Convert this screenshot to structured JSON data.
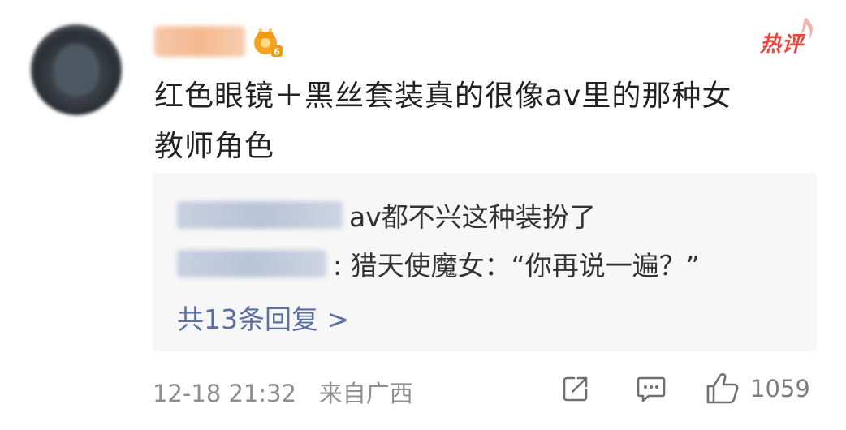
{
  "comment": {
    "hot_label": "热评",
    "level_badge": "6",
    "line1": "红色眼镜＋黑丝套装真的很像av里的那种女",
    "line2": "教师角色"
  },
  "replies": {
    "items": [
      {
        "text": "av都不兴这种装扮了"
      },
      {
        "text": ": 猎天使魔女：“你再说一遍？”"
      }
    ],
    "view_all_label": "共13条回复 >"
  },
  "footer": {
    "date": "12-18 21:32",
    "source": "来自广西",
    "like_count": "1059"
  },
  "icons": {
    "share": "share-icon",
    "comment": "comment-icon",
    "like": "thumbs-up-icon",
    "crown": "crown-badge-icon"
  },
  "colors": {
    "hot": "#e8443b",
    "link": "#5b6fa0",
    "meta": "#8f8f8f",
    "reply_bg": "#f7f7f7"
  }
}
